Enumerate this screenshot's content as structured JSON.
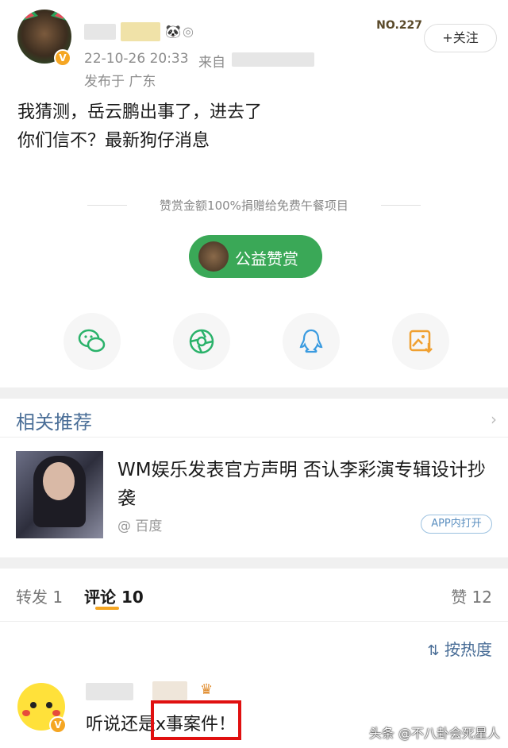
{
  "post": {
    "timestamp": "22-10-26 20:33",
    "from_prefix": "来自",
    "location": "发布于 广东",
    "text_line1": "我猜测，岳云鹏出事了，进去了",
    "text_line2": "你们信不？最新狗仔消息",
    "fans_badge": "NO.227",
    "follow_label": "+关注",
    "verified_mark": "V"
  },
  "reward": {
    "note": "赞赏金额100%捐赠给免费午餐项目",
    "button_label": "公益赞赏"
  },
  "share": {
    "icons": [
      "wechat-icon",
      "moments-icon",
      "qq-icon",
      "save-image-icon"
    ]
  },
  "related": {
    "title": "相关推荐",
    "item": {
      "headline": "WM娱乐发表官方声明 否认李彩演专辑设计抄袭",
      "source": "@ 百度",
      "app_button": "APP内打开"
    }
  },
  "tabs": {
    "repost_label": "转发",
    "repost_count": "1",
    "comment_label": "评论",
    "comment_count": "10",
    "like_label": "赞",
    "like_count": "12"
  },
  "sort": {
    "label": "按热度"
  },
  "comment": {
    "text_prefix": "听说还是",
    "text_highlight": "x事案件！"
  },
  "watermark": "头条 @不八卦会死星人",
  "colors": {
    "reward_green": "#3aa857",
    "link_blue": "#4a6e97",
    "accent_orange": "#f5a623",
    "highlight_red": "#e01010"
  }
}
